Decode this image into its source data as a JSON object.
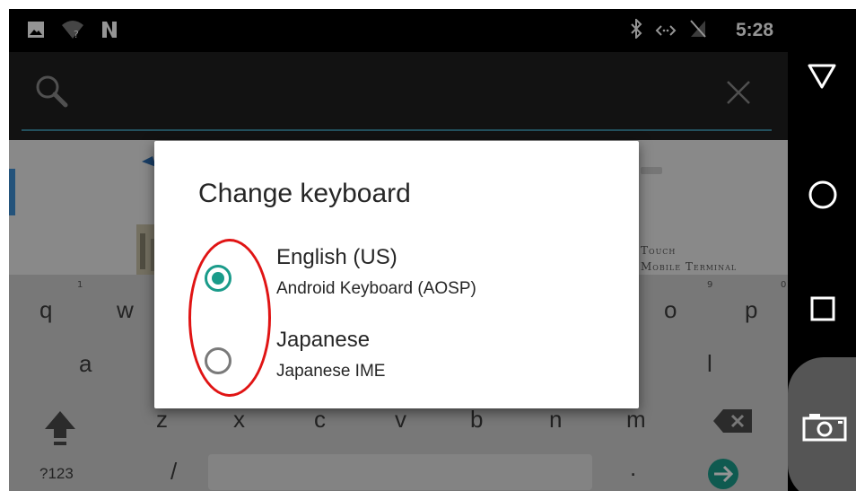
{
  "status_bar": {
    "time": "5:28",
    "icons": [
      "image-icon",
      "wifi-unknown-icon",
      "nfc-icon",
      "bluetooth-icon",
      "data-transfer-icon",
      "no-sim-icon"
    ]
  },
  "search": {
    "value": ""
  },
  "background": {
    "ad_line1": "Touch",
    "ad_line2": "Mobile Terminal"
  },
  "keyboard": {
    "row1": [
      "q",
      "w",
      "o",
      "p"
    ],
    "row1_hints": [
      "1",
      "9",
      "0"
    ],
    "row2": [
      "a",
      "l"
    ],
    "row3": [
      "z",
      "x",
      "c",
      "v",
      "b",
      "n",
      "m"
    ],
    "row4_mode": "?123",
    "row4_slash": "/",
    "row4_period": "."
  },
  "dialog": {
    "title": "Change keyboard",
    "options": [
      {
        "label": "English (US)",
        "sublabel": "Android Keyboard (AOSP)",
        "selected": true
      },
      {
        "label": "Japanese",
        "sublabel": "Japanese IME",
        "selected": false
      }
    ]
  },
  "colors": {
    "accent": "#1a9b8a",
    "annotation": "#e01414"
  }
}
